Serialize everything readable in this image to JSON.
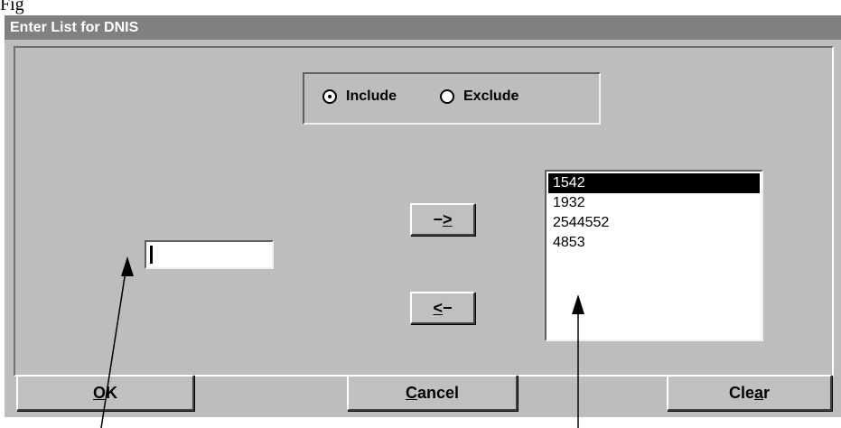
{
  "caption_fragment": "Fig",
  "window": {
    "title": "Enter List for DNIS"
  },
  "mode": {
    "include": {
      "label": "Include",
      "checked": true
    },
    "exclude": {
      "label": "Exclude",
      "checked": false
    }
  },
  "entry_field": {
    "value": ""
  },
  "add_button": {
    "prefix": "−",
    "mnemonic": ">"
  },
  "remove_button": {
    "mnemonic": "<",
    "suffix": "−"
  },
  "list": {
    "items": [
      "1542",
      "1932",
      "2544552",
      "4853"
    ],
    "selected": "1542"
  },
  "footer": {
    "ok": {
      "mnemonic": "O",
      "rest": "K"
    },
    "cancel": {
      "mnemonic": "C",
      "rest": "ancel"
    },
    "clear": {
      "pre": "Cle",
      "mnemonic": "a",
      "rest": "r"
    }
  },
  "colors": {
    "window_bg": "#bdbdbd",
    "titlebar_bg": "#808080",
    "selection_bg": "#000000"
  }
}
